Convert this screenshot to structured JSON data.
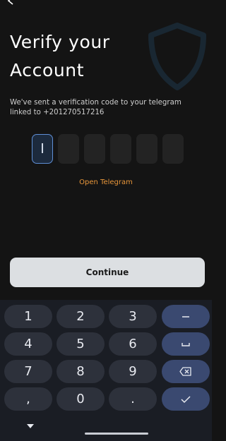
{
  "header": {
    "title_line1": "Verify your",
    "title_line2": "Account"
  },
  "message": {
    "line1": "We've sent a verification code to your telegram",
    "line2": "linked to +201270517216"
  },
  "code": {
    "length": 6,
    "entered": ""
  },
  "link": {
    "open_telegram": "Open Telegram"
  },
  "actions": {
    "continue_label": "Continue"
  },
  "keyboard": {
    "rows": [
      [
        "1",
        "2",
        "3",
        "minus-icon"
      ],
      [
        "4",
        "5",
        "6",
        "space-icon"
      ],
      [
        "7",
        "8",
        "9",
        "backspace-icon"
      ],
      [
        ",",
        "0",
        ".",
        "check-icon"
      ]
    ],
    "key_1": "1",
    "key_2": "2",
    "key_3": "3",
    "key_4": "4",
    "key_5": "5",
    "key_6": "6",
    "key_7": "7",
    "key_8": "8",
    "key_9": "9",
    "key_comma": ",",
    "key_0": "0",
    "key_dot": "."
  },
  "colors": {
    "background": "#141414",
    "accent_link": "#e8963a",
    "focus_border": "#5f8fd6",
    "button_bg": "#dcdfe2",
    "keyboard_bg": "#1a1d24",
    "key_bg": "#2d313b",
    "fn_key_bg": "#3a4970"
  }
}
